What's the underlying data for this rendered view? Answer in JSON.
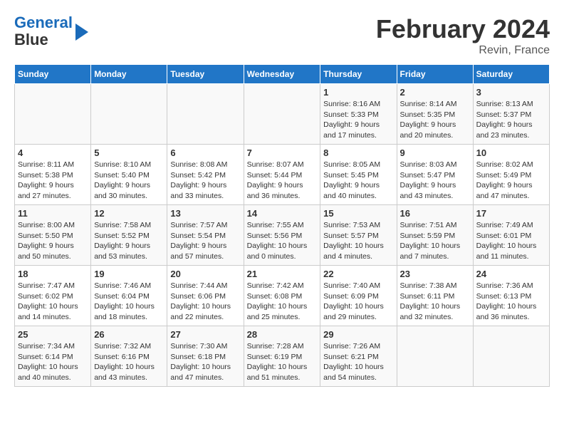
{
  "header": {
    "logo_line1": "General",
    "logo_line2": "Blue",
    "title": "February 2024",
    "subtitle": "Revin, France"
  },
  "days_of_week": [
    "Sunday",
    "Monday",
    "Tuesday",
    "Wednesday",
    "Thursday",
    "Friday",
    "Saturday"
  ],
  "weeks": [
    [
      {
        "day": "",
        "info": ""
      },
      {
        "day": "",
        "info": ""
      },
      {
        "day": "",
        "info": ""
      },
      {
        "day": "",
        "info": ""
      },
      {
        "day": "1",
        "info": "Sunrise: 8:16 AM\nSunset: 5:33 PM\nDaylight: 9 hours\nand 17 minutes."
      },
      {
        "day": "2",
        "info": "Sunrise: 8:14 AM\nSunset: 5:35 PM\nDaylight: 9 hours\nand 20 minutes."
      },
      {
        "day": "3",
        "info": "Sunrise: 8:13 AM\nSunset: 5:37 PM\nDaylight: 9 hours\nand 23 minutes."
      }
    ],
    [
      {
        "day": "4",
        "info": "Sunrise: 8:11 AM\nSunset: 5:38 PM\nDaylight: 9 hours\nand 27 minutes."
      },
      {
        "day": "5",
        "info": "Sunrise: 8:10 AM\nSunset: 5:40 PM\nDaylight: 9 hours\nand 30 minutes."
      },
      {
        "day": "6",
        "info": "Sunrise: 8:08 AM\nSunset: 5:42 PM\nDaylight: 9 hours\nand 33 minutes."
      },
      {
        "day": "7",
        "info": "Sunrise: 8:07 AM\nSunset: 5:44 PM\nDaylight: 9 hours\nand 36 minutes."
      },
      {
        "day": "8",
        "info": "Sunrise: 8:05 AM\nSunset: 5:45 PM\nDaylight: 9 hours\nand 40 minutes."
      },
      {
        "day": "9",
        "info": "Sunrise: 8:03 AM\nSunset: 5:47 PM\nDaylight: 9 hours\nand 43 minutes."
      },
      {
        "day": "10",
        "info": "Sunrise: 8:02 AM\nSunset: 5:49 PM\nDaylight: 9 hours\nand 47 minutes."
      }
    ],
    [
      {
        "day": "11",
        "info": "Sunrise: 8:00 AM\nSunset: 5:50 PM\nDaylight: 9 hours\nand 50 minutes."
      },
      {
        "day": "12",
        "info": "Sunrise: 7:58 AM\nSunset: 5:52 PM\nDaylight: 9 hours\nand 53 minutes."
      },
      {
        "day": "13",
        "info": "Sunrise: 7:57 AM\nSunset: 5:54 PM\nDaylight: 9 hours\nand 57 minutes."
      },
      {
        "day": "14",
        "info": "Sunrise: 7:55 AM\nSunset: 5:56 PM\nDaylight: 10 hours\nand 0 minutes."
      },
      {
        "day": "15",
        "info": "Sunrise: 7:53 AM\nSunset: 5:57 PM\nDaylight: 10 hours\nand 4 minutes."
      },
      {
        "day": "16",
        "info": "Sunrise: 7:51 AM\nSunset: 5:59 PM\nDaylight: 10 hours\nand 7 minutes."
      },
      {
        "day": "17",
        "info": "Sunrise: 7:49 AM\nSunset: 6:01 PM\nDaylight: 10 hours\nand 11 minutes."
      }
    ],
    [
      {
        "day": "18",
        "info": "Sunrise: 7:47 AM\nSunset: 6:02 PM\nDaylight: 10 hours\nand 14 minutes."
      },
      {
        "day": "19",
        "info": "Sunrise: 7:46 AM\nSunset: 6:04 PM\nDaylight: 10 hours\nand 18 minutes."
      },
      {
        "day": "20",
        "info": "Sunrise: 7:44 AM\nSunset: 6:06 PM\nDaylight: 10 hours\nand 22 minutes."
      },
      {
        "day": "21",
        "info": "Sunrise: 7:42 AM\nSunset: 6:08 PM\nDaylight: 10 hours\nand 25 minutes."
      },
      {
        "day": "22",
        "info": "Sunrise: 7:40 AM\nSunset: 6:09 PM\nDaylight: 10 hours\nand 29 minutes."
      },
      {
        "day": "23",
        "info": "Sunrise: 7:38 AM\nSunset: 6:11 PM\nDaylight: 10 hours\nand 32 minutes."
      },
      {
        "day": "24",
        "info": "Sunrise: 7:36 AM\nSunset: 6:13 PM\nDaylight: 10 hours\nand 36 minutes."
      }
    ],
    [
      {
        "day": "25",
        "info": "Sunrise: 7:34 AM\nSunset: 6:14 PM\nDaylight: 10 hours\nand 40 minutes."
      },
      {
        "day": "26",
        "info": "Sunrise: 7:32 AM\nSunset: 6:16 PM\nDaylight: 10 hours\nand 43 minutes."
      },
      {
        "day": "27",
        "info": "Sunrise: 7:30 AM\nSunset: 6:18 PM\nDaylight: 10 hours\nand 47 minutes."
      },
      {
        "day": "28",
        "info": "Sunrise: 7:28 AM\nSunset: 6:19 PM\nDaylight: 10 hours\nand 51 minutes."
      },
      {
        "day": "29",
        "info": "Sunrise: 7:26 AM\nSunset: 6:21 PM\nDaylight: 10 hours\nand 54 minutes."
      },
      {
        "day": "",
        "info": ""
      },
      {
        "day": "",
        "info": ""
      }
    ]
  ]
}
